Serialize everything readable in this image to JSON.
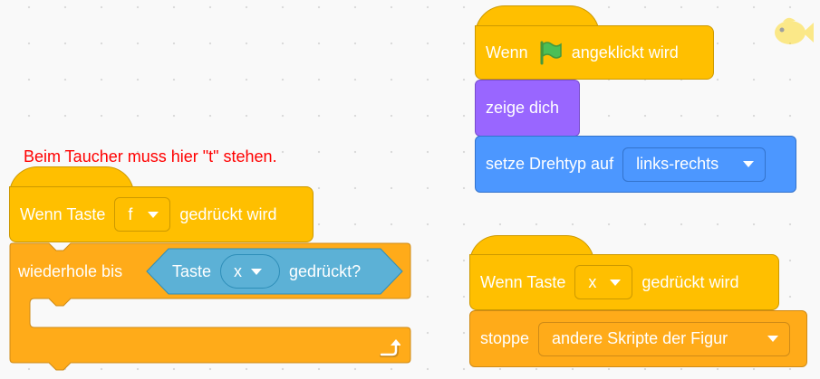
{
  "comment": "Beim Taucher muss hier \"t\" stehen.",
  "left_script": {
    "hat": {
      "prefix": "Wenn Taste",
      "key": "f",
      "suffix": "gedrückt wird"
    },
    "repeat_until": {
      "label": "wiederhole bis",
      "sensing_prefix": "Taste",
      "sensing_key": "x",
      "sensing_suffix": "gedrückt?"
    }
  },
  "top_script": {
    "hat": {
      "prefix": "Wenn",
      "icon": "green-flag-icon",
      "suffix": "angeklickt wird"
    },
    "show": {
      "label": "zeige dich"
    },
    "rotation": {
      "label": "setze Drehtyp auf",
      "value": "links-rechts"
    }
  },
  "bottom_script": {
    "hat": {
      "prefix": "Wenn Taste",
      "key": "x",
      "suffix": "gedrückt wird"
    },
    "stop": {
      "label": "stoppe",
      "value": "andere Skripte der Figur"
    }
  },
  "sprite": {
    "icon": "fish-sprite-icon"
  },
  "colors": {
    "events": "#ffbf00",
    "control": "#ffab19",
    "looks": "#9966ff",
    "motion": "#4c97ff",
    "sensing": "#5cb1d6",
    "comment": "#ff0000"
  }
}
